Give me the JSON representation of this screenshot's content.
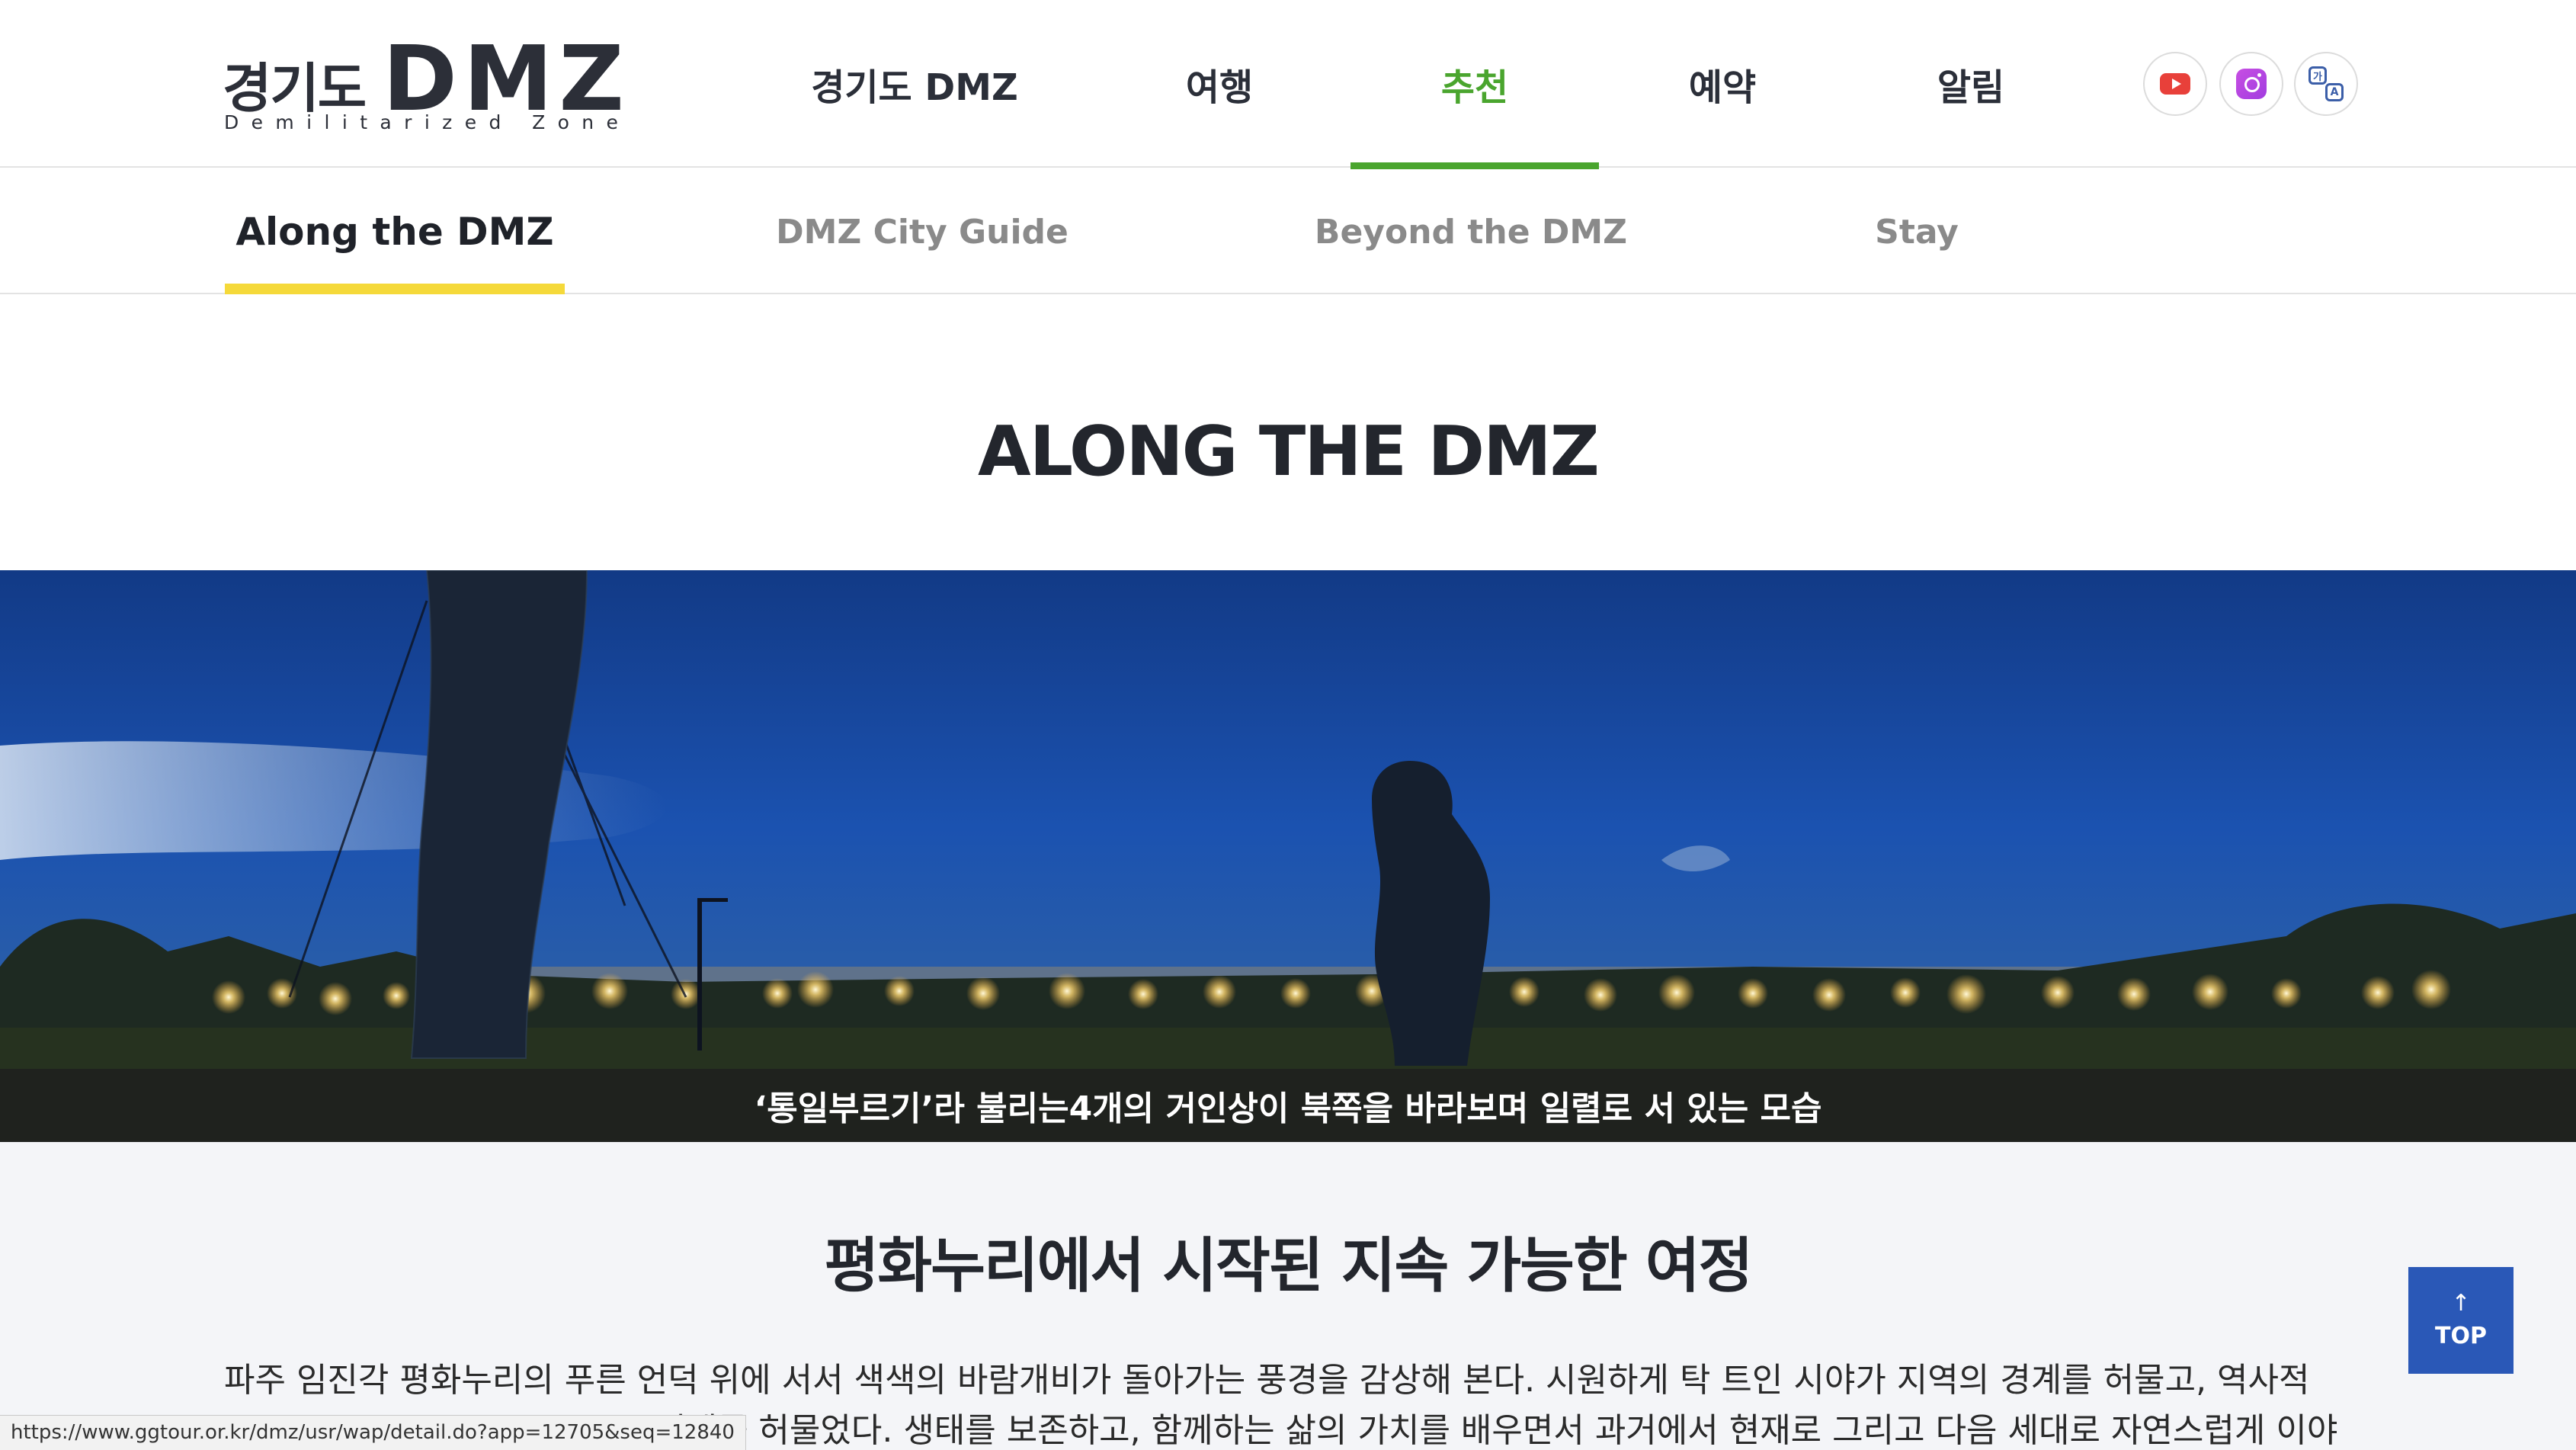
{
  "logo": {
    "korean": "경기도",
    "title": "DMZ",
    "subtitle": "Demilitarized Zone"
  },
  "gnb": {
    "items": [
      {
        "label": "경기도 DMZ",
        "active": false
      },
      {
        "label": "여행",
        "active": false
      },
      {
        "label": "추천",
        "active": true
      },
      {
        "label": "예약",
        "active": false
      },
      {
        "label": "알림",
        "active": false
      }
    ]
  },
  "sns": [
    {
      "name": "youtube-icon"
    },
    {
      "name": "instagram-icon"
    },
    {
      "name": "language-icon",
      "glyph_a": "가",
      "glyph_b": "A"
    }
  ],
  "subnav": {
    "items": [
      {
        "label": "Along the DMZ",
        "active": true
      },
      {
        "label": "DMZ City Guide",
        "active": false
      },
      {
        "label": "Beyond the DMZ",
        "active": false
      },
      {
        "label": "Stay",
        "active": false
      }
    ]
  },
  "page": {
    "title": "ALONG THE DMZ"
  },
  "hero": {
    "caption": "‘통일부르기’라 불리는4개의 거인상이 북쪽을 바라보며 일렬로 서 있는 모습"
  },
  "content": {
    "section_title": "평화누리에서 시작된 지속 가능한 여정",
    "paragraph_line1": "파주 임진각 평화누리의 푸른 언덕 위에 서서 색색의 바람개비가 돌아가는 풍경을 감상해 본다. 시원하게 탁 트인 시야가 지역의 경계를 허물고, 역사적",
    "paragraph_line2": "경계를 허물었다. 생태를 보존하고, 함께하는 삶의 가치를 배우면서 과거에서 현재로 그리고 다음 세대로 자연스럽게 이야기가"
  },
  "top_button": {
    "label": "TOP",
    "arrow": "↑"
  },
  "status_bar": {
    "url": "https://www.ggtour.or.kr/dmz/usr/wap/detail.do?app=12705&seq=12840"
  },
  "colors": {
    "accent_green": "#4aa52e",
    "subnav_underline": "#f5d93a",
    "top_button": "#2a58b7",
    "text_dark": "#23262d"
  }
}
